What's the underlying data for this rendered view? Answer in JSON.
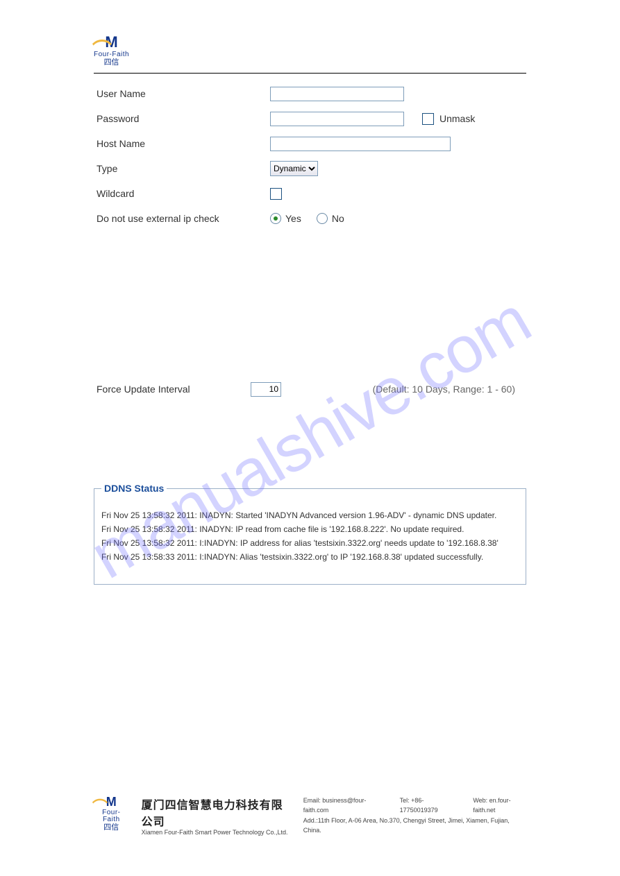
{
  "brand": {
    "name_en": "Four-Faith",
    "name_cjk": "四信"
  },
  "watermark": "manualshive.com",
  "form": {
    "username": {
      "label": "User Name",
      "value": ""
    },
    "password": {
      "label": "Password",
      "value": ""
    },
    "unmask_label": "Unmask",
    "hostname": {
      "label": "Host Name",
      "value": ""
    },
    "type": {
      "label": "Type",
      "selected": "Dynamic"
    },
    "wildcard": {
      "label": "Wildcard"
    },
    "ext_ip": {
      "label": "Do not use external ip check",
      "yes": "Yes",
      "no": "No"
    },
    "force_update": {
      "label": "Force Update Interval",
      "value": "10",
      "hint": "(Default: 10 Days, Range: 1 - 60)"
    }
  },
  "status": {
    "title": "DDNS Status",
    "lines": [
      "Fri Nov 25 13:58:32 2011: INADYN: Started 'INADYN Advanced version 1.96-ADV' - dynamic DNS updater.",
      "Fri Nov 25 13:58:32 2011: INADYN: IP read from cache file is '192.168.8.222'. No update required.",
      "Fri Nov 25 13:58:32 2011: I:INADYN: IP address for alias 'testsixin.3322.org' needs update to '192.168.8.38'",
      "Fri Nov 25 13:58:33 2011: I:INADYN: Alias 'testsixin.3322.org' to IP '192.168.8.38' updated successfully."
    ]
  },
  "footer": {
    "company_cn": "厦门四信智慧电力科技有限公司",
    "company_en": "Xiamen Four-Faith Smart Power Technology Co.,Ltd.",
    "email_label": "Email: business@four-faith.com",
    "tel_label": "Tel: +86-17750019379",
    "web_label": "Web: en.four-faith.net",
    "addr": "Add.:11th Floor, A-06 Area, No.370, Chengyi Street, Jimei, Xiamen, Fujian, China."
  }
}
